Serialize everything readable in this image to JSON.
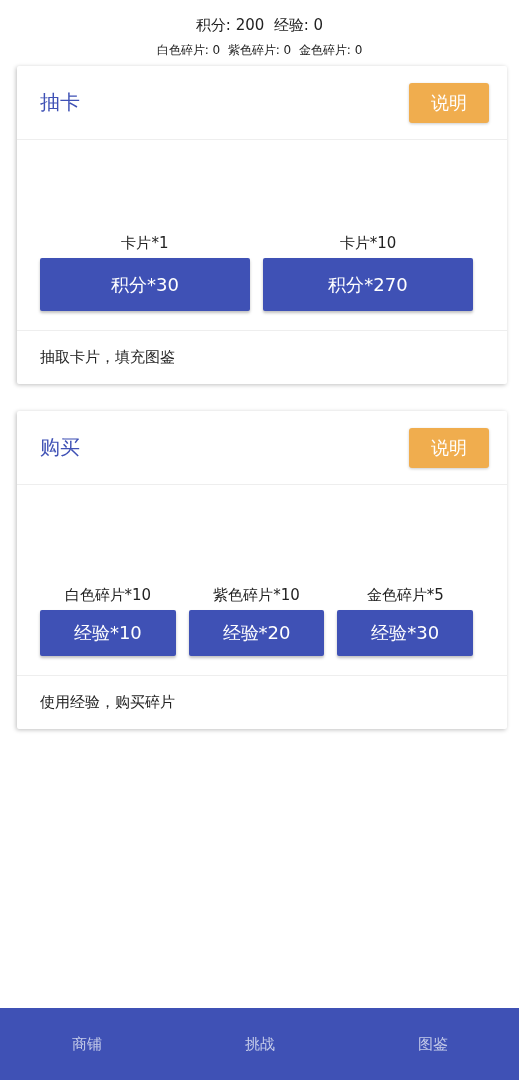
{
  "stats": {
    "primary": "积分: 200  经验: 0",
    "fragments": "白色碎片: 0  紫色碎片: 0  金色碎片: 0"
  },
  "cards": [
    {
      "title": "抽卡",
      "help_button": "说明",
      "options": [
        {
          "label": "卡片*1",
          "button": "积分*30"
        },
        {
          "label": "卡片*10",
          "button": "积分*270"
        }
      ],
      "footer": "抽取卡片，填充图鉴"
    },
    {
      "title": "购买",
      "help_button": "说明",
      "options": [
        {
          "label": "白色碎片*10",
          "button": "经验*10"
        },
        {
          "label": "紫色碎片*10",
          "button": "经验*20"
        },
        {
          "label": "金色碎片*5",
          "button": "经验*30"
        }
      ],
      "footer": "使用经验，购买碎片"
    }
  ],
  "bottom_nav": [
    {
      "label": "商铺",
      "selected": false
    },
    {
      "label": "挑战",
      "selected": false
    },
    {
      "label": "图鉴",
      "selected": false
    }
  ]
}
